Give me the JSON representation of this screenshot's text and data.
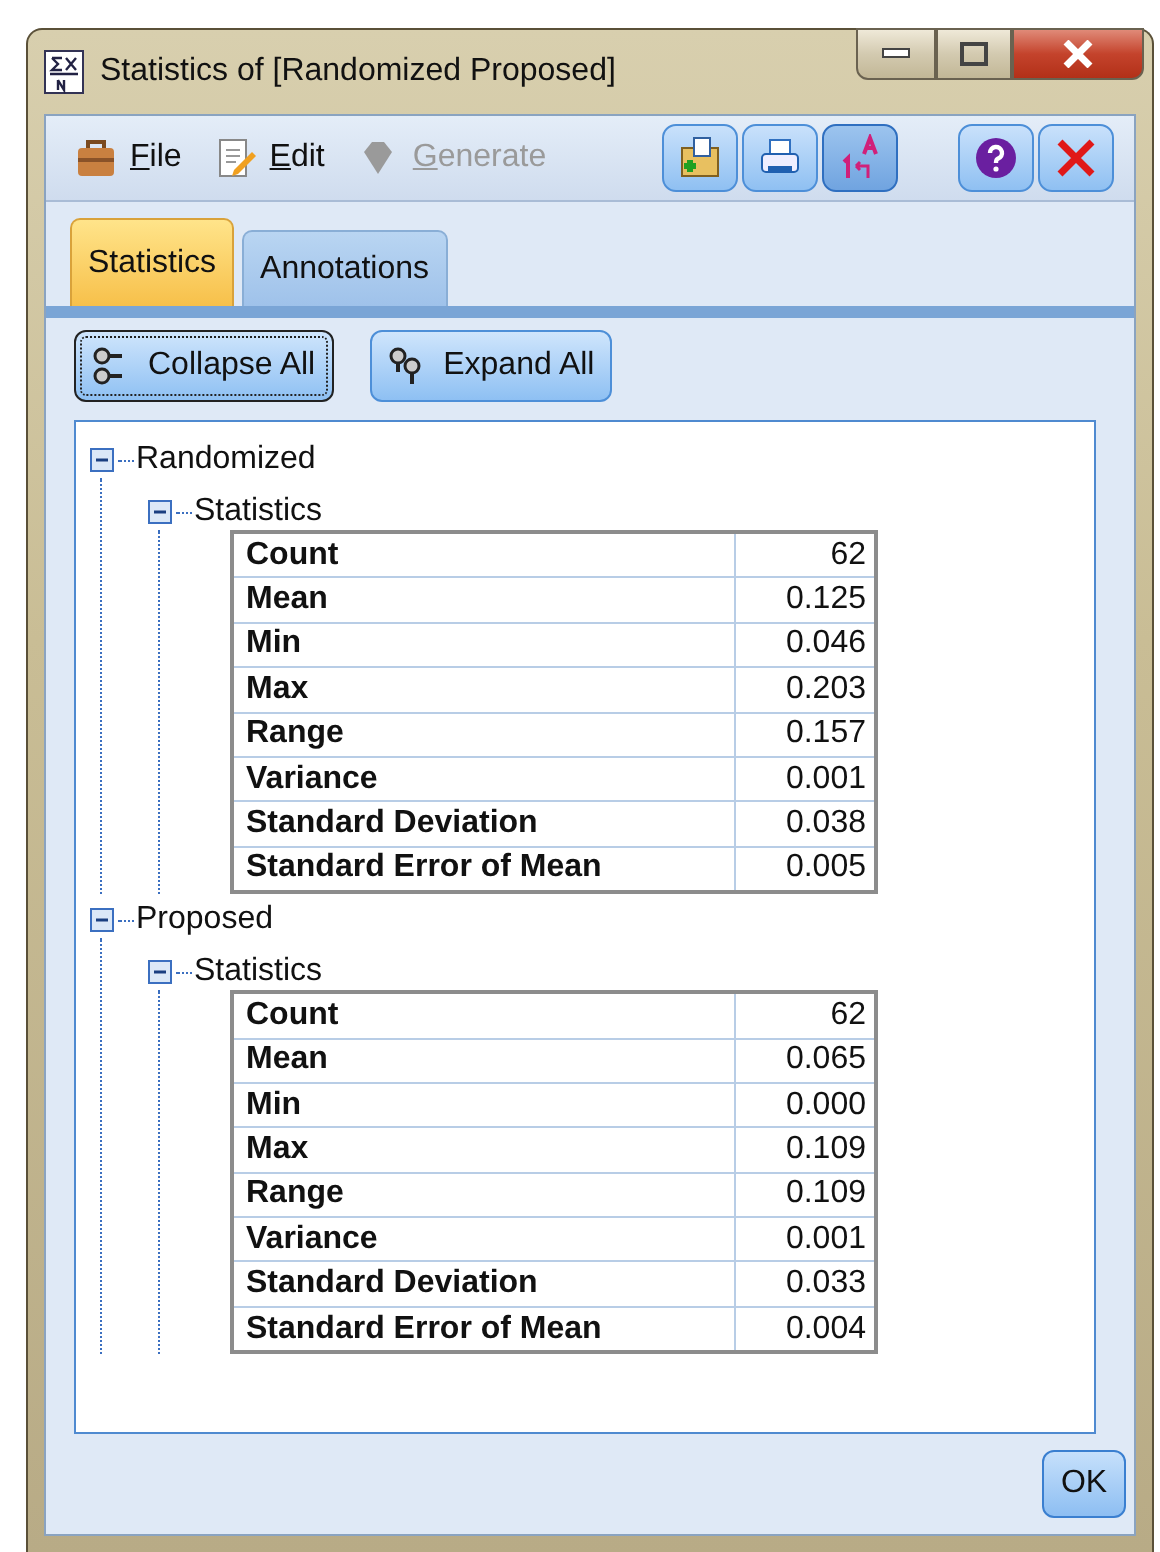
{
  "window": {
    "title": "Statistics of [Randomized Proposed]"
  },
  "menu": [
    {
      "label": "File",
      "disabled": false
    },
    {
      "label": "Edit",
      "disabled": false
    },
    {
      "label": "Generate",
      "disabled": true
    }
  ],
  "tabs": [
    {
      "label": "Statistics",
      "selected": true
    },
    {
      "label": "Annotations",
      "selected": false
    }
  ],
  "actions": [
    {
      "label": "Collapse All",
      "focused": true
    },
    {
      "label": "Expand All",
      "focused": false
    }
  ],
  "tree": [
    {
      "label": "Randomized",
      "expanded": true,
      "children": [
        {
          "label": "Statistics",
          "expanded": true,
          "rows": [
            [
              "Count",
              "62"
            ],
            [
              "Mean",
              "0.125"
            ],
            [
              "Min",
              "0.046"
            ],
            [
              "Max",
              "0.203"
            ],
            [
              "Range",
              "0.157"
            ],
            [
              "Variance",
              "0.001"
            ],
            [
              "Standard Deviation",
              "0.038"
            ],
            [
              "Standard Error of Mean",
              "0.005"
            ]
          ]
        }
      ]
    },
    {
      "label": "Proposed",
      "expanded": true,
      "children": [
        {
          "label": "Statistics",
          "expanded": true,
          "rows": [
            [
              "Count",
              "62"
            ],
            [
              "Mean",
              "0.065"
            ],
            [
              "Min",
              "0.000"
            ],
            [
              "Max",
              "0.109"
            ],
            [
              "Range",
              "0.109"
            ],
            [
              "Variance",
              "0.001"
            ],
            [
              "Standard Deviation",
              "0.033"
            ],
            [
              "Standard Error of Mean",
              "0.004"
            ]
          ]
        }
      ]
    }
  ],
  "ok_button": "OK"
}
